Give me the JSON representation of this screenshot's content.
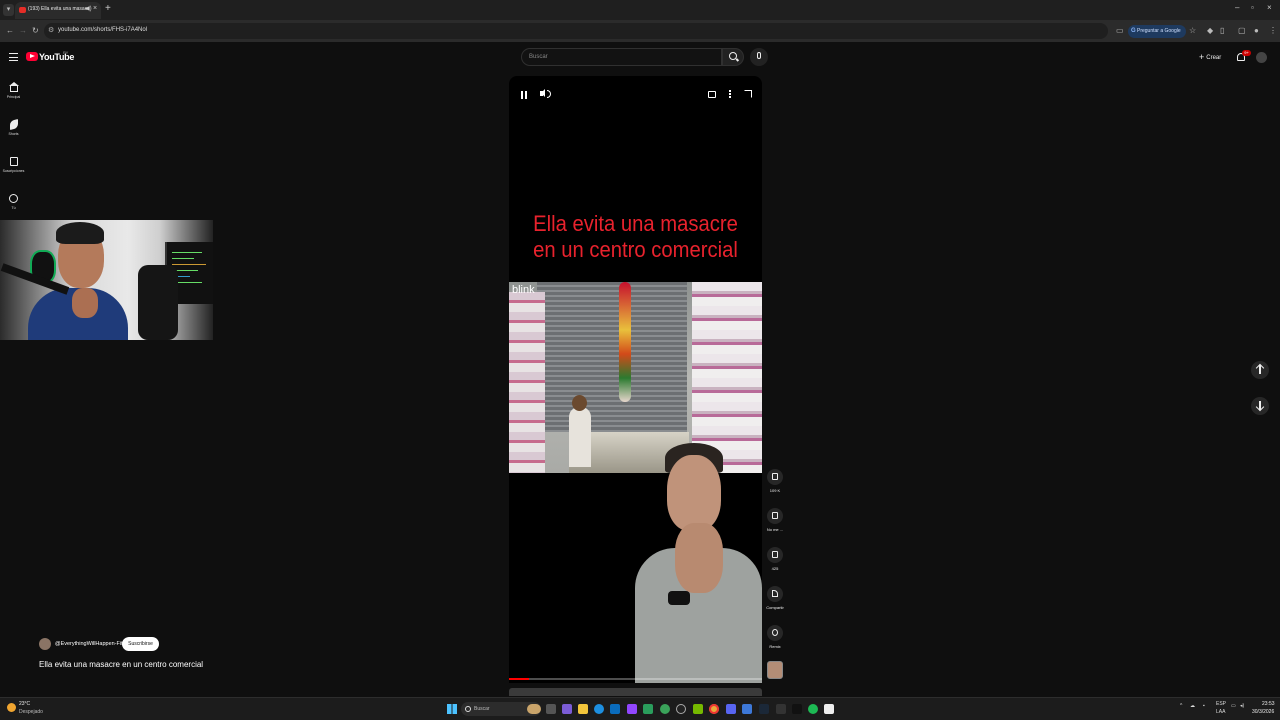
{
  "browser": {
    "tab_title": "(193) Ella evita una masacre",
    "url": "youtube.com/shorts/FHS-i7A4Nol",
    "ask_google": "Preguntar a Google"
  },
  "youtube": {
    "wordmark": "YouTube",
    "country": "PY",
    "search_placeholder": "Buscar",
    "create_label": "Crear",
    "notifications_badge": "9+"
  },
  "guide": [
    {
      "label": "Principal"
    },
    {
      "label": "Shorts"
    },
    {
      "label": "Suscripciones"
    },
    {
      "label": "Tú"
    }
  ],
  "short": {
    "overlay_text": "Ella evita una masacre en un centro comercial",
    "cam_brand": "blink",
    "progress": 0.08,
    "channel": "@EverythingWillHappen-Fit",
    "subscribe_label": "Suscribirse",
    "title": "Ella evita una masacre en un centro comercial"
  },
  "actions": {
    "likes": "109 K",
    "dislike": "No me ...",
    "comments": "425",
    "share": "Compartir",
    "remix": "Remix"
  },
  "taskbar": {
    "temp": "23°C",
    "weather": "Despejado",
    "search": "Buscar",
    "lang1": "ESP",
    "lang2": "LAA",
    "time": "23:53",
    "date": "30/3/2026"
  },
  "colors": {
    "headline": "#e8222d",
    "brand_red": "#ff0033",
    "page_bg": "#0f0f0f"
  }
}
